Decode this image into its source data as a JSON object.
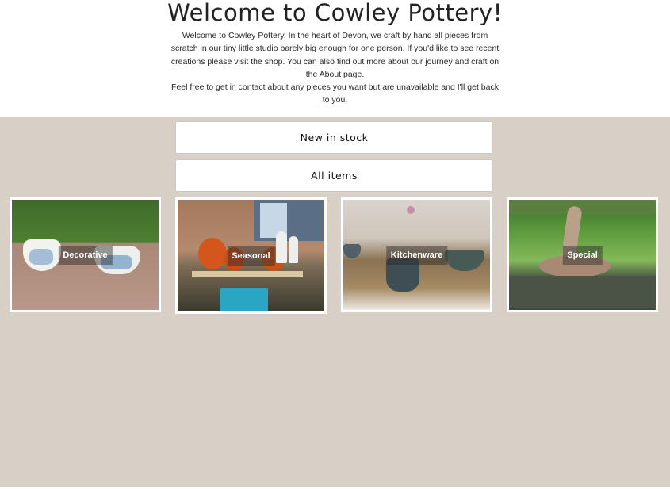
{
  "hero": {
    "title": "Welcome to Cowley Pottery!",
    "intro": "Welcome to Cowley Pottery. In the heart of Devon, we craft by hand all pieces from scratch in our tiny little studio barely big enough for one person. If you'd like to see recent creations please visit the shop. You can also find out more about our journey and craft on the About page.",
    "contact": "Feel free to get in contact about any pieces you want but are unavailable and I'll get back to you."
  },
  "buttons": {
    "new_in_stock": "New in stock",
    "all_items": "All items"
  },
  "categories": [
    {
      "label": "Decorative"
    },
    {
      "label": "Seasonal"
    },
    {
      "label": "Kitchenware"
    },
    {
      "label": "Special"
    }
  ],
  "colors": {
    "background": "#d8cfc6",
    "header_bg": "#ffffff",
    "button_bg": "#ffffff"
  }
}
